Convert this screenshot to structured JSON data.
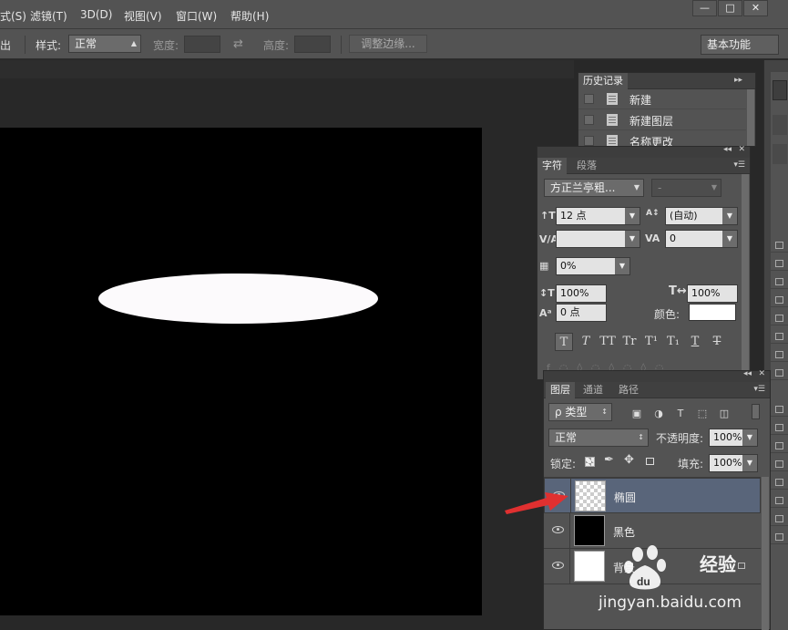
{
  "menu": {
    "items": [
      "文件(S)",
      "滤镜(T)",
      "3D(D)",
      "视图(V)",
      "窗口(W)",
      "帮助(H)"
    ],
    "visible_items": [
      "滤镜(T)",
      "3D(D)",
      "视图(V)",
      "窗口(W)",
      "帮助(H)"
    ],
    "partial_item": "式(S)"
  },
  "window": {
    "minimize": "—",
    "restore": "□",
    "close": "✕"
  },
  "options": {
    "cut_label": "出",
    "style_label": "样式:",
    "style_value": "正常",
    "width_label": "宽度:",
    "height_label": "高度:",
    "refine_button": "调整边缘...",
    "workspace": "基本功能"
  },
  "history": {
    "tab": "历史记录",
    "items": [
      "新建",
      "新建图层",
      "名称更改"
    ]
  },
  "character": {
    "tabs": [
      "字符",
      "段落"
    ],
    "font_family": "方正兰亭粗...",
    "font_style": "-",
    "font_size": "12 点",
    "leading": "(自动)",
    "kerning": "",
    "tracking": "0",
    "tsume": "0%",
    "vscale": "100%",
    "hscale": "100%",
    "baseline": "0 点",
    "color_label": "颜色:",
    "color_value": "#ffffff",
    "style_buttons": [
      "T",
      "T",
      "TT",
      "Tr",
      "T¹",
      "T₁",
      "T",
      "T"
    ]
  },
  "layers": {
    "tabs": [
      "图层",
      "通道",
      "路径"
    ],
    "filter": "ρ 类型",
    "blend_mode": "正常",
    "opacity_label": "不透明度:",
    "opacity": "100%",
    "lock_label": "锁定:",
    "fill_label": "填充:",
    "fill": "100%",
    "items": [
      {
        "name": "椭圆",
        "selected": true
      },
      {
        "name": "黑色",
        "selected": false
      },
      {
        "name": "背景",
        "selected": false
      }
    ]
  },
  "colors": {
    "accent": "#59657a",
    "arrow": "#e03030",
    "canvas": "#000000",
    "shape": "#fcfafc"
  },
  "watermark": {
    "brand": "Baià百",
    "text": "经验",
    "url": "jingyan.baidu.com"
  }
}
